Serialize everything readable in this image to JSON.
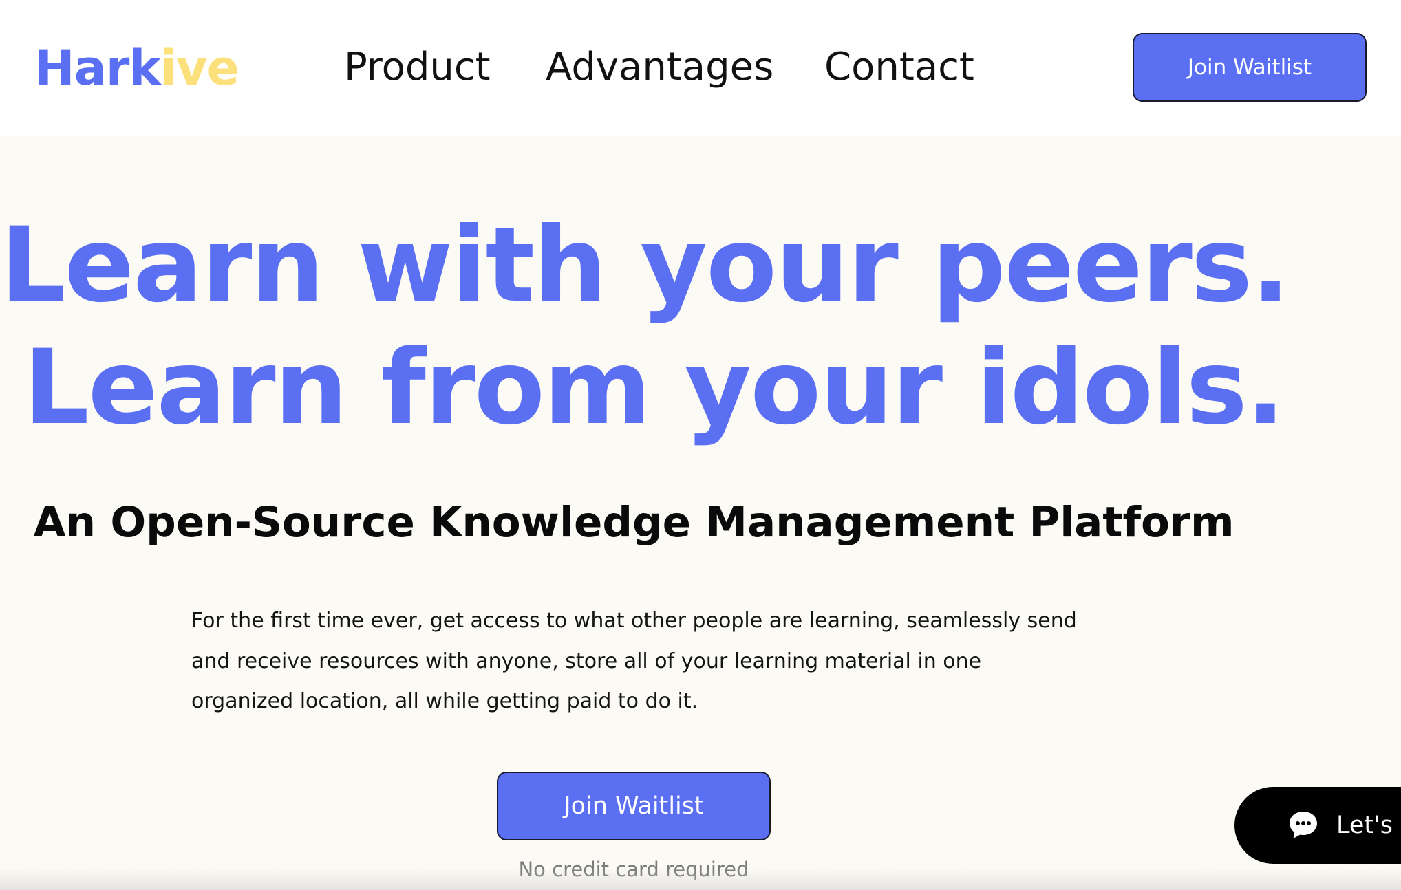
{
  "header": {
    "logo": {
      "part1": "Hark",
      "part2": "ive"
    },
    "nav": [
      {
        "label": "Product"
      },
      {
        "label": "Advantages"
      },
      {
        "label": "Contact"
      }
    ],
    "cta_label": "Join Waitlist"
  },
  "hero": {
    "headline_line1": "Learn with your peers.",
    "headline_line2": "Learn from your idols.",
    "subheadline": "An Open-Source Knowledge Management Platform",
    "body_lines": [
      "For the first time ever, get access to what other people are learning, seamlessly send",
      "and receive resources with anyone, store all of your learning material in one",
      "organized location, all while getting paid to do it."
    ],
    "cta_label": "Join Waitlist",
    "cta_note": "No credit card required"
  },
  "chat_widget": {
    "label": "Let's C",
    "icon": "chat-bubble-icon"
  },
  "colors": {
    "brand_blue": "#5b6ff2",
    "brand_yellow": "#fbe07b",
    "hero_background": "#fcfaf5",
    "chat_background": "#000000"
  }
}
